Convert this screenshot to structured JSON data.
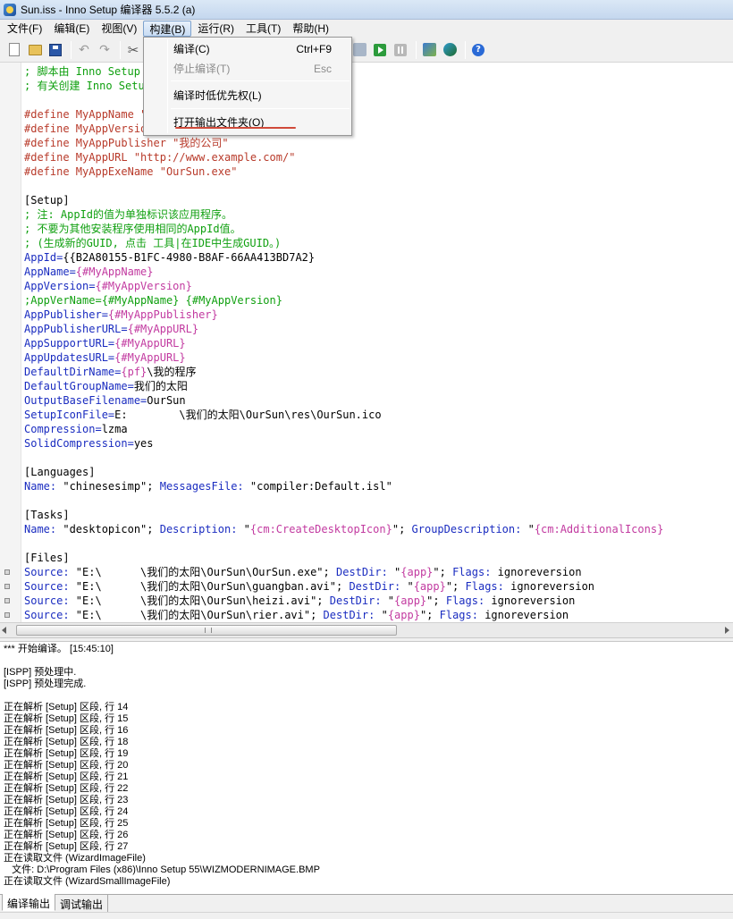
{
  "window": {
    "title": "Sun.iss - Inno Setup 编译器 5.5.2 (a)"
  },
  "menubar": [
    {
      "label": "文件(F)",
      "active": false
    },
    {
      "label": "编辑(E)",
      "active": false
    },
    {
      "label": "视图(V)",
      "active": false
    },
    {
      "label": "构建(B)",
      "active": true
    },
    {
      "label": "运行(R)",
      "active": false
    },
    {
      "label": "工具(T)",
      "active": false
    },
    {
      "label": "帮助(H)",
      "active": false
    }
  ],
  "toolbar": {
    "icons": [
      "new-file-icon",
      "open-folder-icon",
      "save-icon",
      "undo-icon",
      "redo-icon",
      "cut-icon",
      "run-icon",
      "pause-icon",
      "compile-icon",
      "wizard-icon",
      "help-icon"
    ]
  },
  "build_menu": {
    "items": [
      {
        "label": "编译(C)",
        "shortcut": "Ctrl+F9",
        "disabled": false
      },
      {
        "label": "停止编译(T)",
        "shortcut": "Esc",
        "disabled": true
      },
      {
        "label": "编译时低优先权(L)",
        "shortcut": "",
        "disabled": false
      },
      {
        "label": "打开输出文件夹(O)",
        "shortcut": "",
        "disabled": false
      }
    ],
    "highlight_color": "#d04a3a"
  },
  "editor": {
    "lines": [
      [
        {
          "t": "; 脚本由 Inno Setup 脚本向导 生成！",
          "c": "comment"
        }
      ],
      [
        {
          "t": "; 有关创建 Inno Setup 脚本文件的详细资料请查阅帮助文档！",
          "c": "comment"
        }
      ],
      [],
      [
        {
          "t": "#define MyAppName \"我们的太阳\"",
          "c": "define"
        }
      ],
      [
        {
          "t": "#define MyAppVersion \"1.5\"",
          "c": "define"
        }
      ],
      [
        {
          "t": "#define MyAppPublisher \"我的公司\"",
          "c": "define"
        }
      ],
      [
        {
          "t": "#define MyAppURL \"http://www.example.com/\"",
          "c": "define"
        }
      ],
      [
        {
          "t": "#define MyAppExeName \"OurSun.exe\"",
          "c": "define"
        }
      ],
      [],
      [
        {
          "t": "[Setup]",
          "c": "section"
        }
      ],
      [
        {
          "t": "; 注: AppId的值为单独标识该应用程序。",
          "c": "comment"
        }
      ],
      [
        {
          "t": "; 不要为其他安装程序使用相同的AppId值。",
          "c": "comment"
        }
      ],
      [
        {
          "t": "; (生成新的GUID, 点击 工具|在IDE中生成GUID。)",
          "c": "comment"
        }
      ],
      [
        {
          "t": "AppId=",
          "c": "key"
        },
        {
          "t": "{{B2A80155-B1FC-4980-B8AF-66AA413BD7A2}",
          "c": "plain"
        }
      ],
      [
        {
          "t": "AppName=",
          "c": "key"
        },
        {
          "t": "{#MyAppName}",
          "c": "const"
        }
      ],
      [
        {
          "t": "AppVersion=",
          "c": "key"
        },
        {
          "t": "{#MyAppVersion}",
          "c": "const"
        }
      ],
      [
        {
          "t": ";AppVerName={#MyAppName} {#MyAppVersion}",
          "c": "comment"
        }
      ],
      [
        {
          "t": "AppPublisher=",
          "c": "key"
        },
        {
          "t": "{#MyAppPublisher}",
          "c": "const"
        }
      ],
      [
        {
          "t": "AppPublisherURL=",
          "c": "key"
        },
        {
          "t": "{#MyAppURL}",
          "c": "const"
        }
      ],
      [
        {
          "t": "AppSupportURL=",
          "c": "key"
        },
        {
          "t": "{#MyAppURL}",
          "c": "const"
        }
      ],
      [
        {
          "t": "AppUpdatesURL=",
          "c": "key"
        },
        {
          "t": "{#MyAppURL}",
          "c": "const"
        }
      ],
      [
        {
          "t": "DefaultDirName=",
          "c": "key"
        },
        {
          "t": "{pf}",
          "c": "const"
        },
        {
          "t": "\\我的程序",
          "c": "plain"
        }
      ],
      [
        {
          "t": "DefaultGroupName=",
          "c": "key"
        },
        {
          "t": "我们的太阳",
          "c": "plain"
        }
      ],
      [
        {
          "t": "OutputBaseFilename=",
          "c": "key"
        },
        {
          "t": "OurSun",
          "c": "plain"
        }
      ],
      [
        {
          "t": "SetupIconFile=",
          "c": "key"
        },
        {
          "t": "E:        \\我们的太阳\\OurSun\\res\\OurSun.ico",
          "c": "plain"
        }
      ],
      [
        {
          "t": "Compression=",
          "c": "key"
        },
        {
          "t": "lzma",
          "c": "plain"
        }
      ],
      [
        {
          "t": "SolidCompression=",
          "c": "key"
        },
        {
          "t": "yes",
          "c": "plain"
        }
      ],
      [],
      [
        {
          "t": "[Languages]",
          "c": "section"
        }
      ],
      [
        {
          "t": "Name: ",
          "c": "key"
        },
        {
          "t": "\"chinesesimp\"; ",
          "c": "plain"
        },
        {
          "t": "MessagesFile: ",
          "c": "key"
        },
        {
          "t": "\"compiler:Default.isl\"",
          "c": "plain"
        }
      ],
      [],
      [
        {
          "t": "[Tasks]",
          "c": "section"
        }
      ],
      [
        {
          "t": "Name: ",
          "c": "key"
        },
        {
          "t": "\"desktopicon\"; ",
          "c": "plain"
        },
        {
          "t": "Description: ",
          "c": "key"
        },
        {
          "t": "\"",
          "c": "plain"
        },
        {
          "t": "{cm:CreateDesktopIcon}",
          "c": "const"
        },
        {
          "t": "\"; ",
          "c": "plain"
        },
        {
          "t": "GroupDescription: ",
          "c": "key"
        },
        {
          "t": "\"",
          "c": "plain"
        },
        {
          "t": "{cm:AdditionalIcons}",
          "c": "const"
        }
      ],
      [],
      [
        {
          "t": "[Files]",
          "c": "section"
        }
      ],
      [
        {
          "t": "Source: ",
          "c": "key"
        },
        {
          "t": "\"E:\\      \\我们的太阳\\OurSun\\OurSun.exe\"; ",
          "c": "plain"
        },
        {
          "t": "DestDir: ",
          "c": "key"
        },
        {
          "t": "\"",
          "c": "plain"
        },
        {
          "t": "{app}",
          "c": "const"
        },
        {
          "t": "\"; ",
          "c": "plain"
        },
        {
          "t": "Flags: ",
          "c": "key"
        },
        {
          "t": "ignoreversion",
          "c": "plain"
        }
      ],
      [
        {
          "t": "Source: ",
          "c": "key"
        },
        {
          "t": "\"E:\\      \\我们的太阳\\OurSun\\guangban.avi\"; ",
          "c": "plain"
        },
        {
          "t": "DestDir: ",
          "c": "key"
        },
        {
          "t": "\"",
          "c": "plain"
        },
        {
          "t": "{app}",
          "c": "const"
        },
        {
          "t": "\"; ",
          "c": "plain"
        },
        {
          "t": "Flags: ",
          "c": "key"
        },
        {
          "t": "ignoreversion",
          "c": "plain"
        }
      ],
      [
        {
          "t": "Source: ",
          "c": "key"
        },
        {
          "t": "\"E:\\      \\我们的太阳\\OurSun\\heizi.avi\"; ",
          "c": "plain"
        },
        {
          "t": "DestDir: ",
          "c": "key"
        },
        {
          "t": "\"",
          "c": "plain"
        },
        {
          "t": "{app}",
          "c": "const"
        },
        {
          "t": "\"; ",
          "c": "plain"
        },
        {
          "t": "Flags: ",
          "c": "key"
        },
        {
          "t": "ignoreversion",
          "c": "plain"
        }
      ],
      [
        {
          "t": "Source: ",
          "c": "key"
        },
        {
          "t": "\"E:\\      \\我们的太阳\\OurSun\\rier.avi\"; ",
          "c": "plain"
        },
        {
          "t": "DestDir: ",
          "c": "key"
        },
        {
          "t": "\"",
          "c": "plain"
        },
        {
          "t": "{app}",
          "c": "const"
        },
        {
          "t": "\"; ",
          "c": "plain"
        },
        {
          "t": "Flags: ",
          "c": "key"
        },
        {
          "t": "ignoreversion",
          "c": "plain"
        }
      ]
    ],
    "marker_lines": [
      35,
      36,
      37,
      38
    ],
    "colors": {
      "comment": "#10a010",
      "define": "#b83a2a",
      "key": "#1a2cc0",
      "const": "#c23aa0",
      "plain": "#000000"
    }
  },
  "output": {
    "lines": [
      "*** 开始编译。 [15:45:10]",
      "",
      "[ISPP] 预处理中.",
      "[ISPP] 预处理完成.",
      "",
      "正在解析 [Setup] 区段, 行 14",
      "正在解析 [Setup] 区段, 行 15",
      "正在解析 [Setup] 区段, 行 16",
      "正在解析 [Setup] 区段, 行 18",
      "正在解析 [Setup] 区段, 行 19",
      "正在解析 [Setup] 区段, 行 20",
      "正在解析 [Setup] 区段, 行 21",
      "正在解析 [Setup] 区段, 行 22",
      "正在解析 [Setup] 区段, 行 23",
      "正在解析 [Setup] 区段, 行 24",
      "正在解析 [Setup] 区段, 行 25",
      "正在解析 [Setup] 区段, 行 26",
      "正在解析 [Setup] 区段, 行 27",
      "正在读取文件 (WizardImageFile)",
      "   文件: D:\\Program Files (x86)\\Inno Setup 55\\WIZMODERNIMAGE.BMP",
      "正在读取文件 (WizardSmallImageFile)"
    ]
  },
  "tabs": [
    {
      "label": "编译输出",
      "active": true
    },
    {
      "label": "调试输出",
      "active": false
    }
  ]
}
